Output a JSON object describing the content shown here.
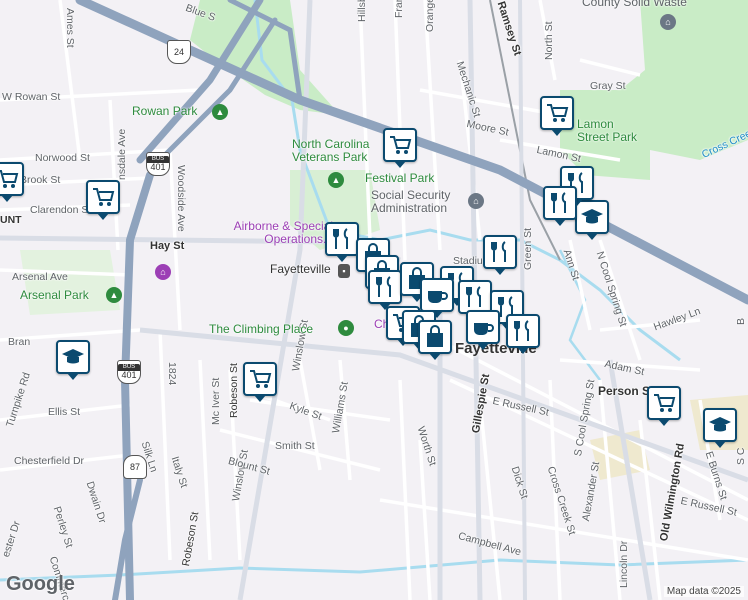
{
  "streets": {
    "blue": "Blue S",
    "ames": "Ames St",
    "w_rowan": "W Rowan St",
    "norwood": "Norwood St",
    "brook": "Brook St",
    "clarendon": "Clarendon St",
    "hay": "Hay St",
    "arsenal": "Arsenal Ave",
    "bran": "Bran",
    "turnpike": "Turnpike Rd",
    "ellis": "Ellis St",
    "chesterfield": "Chesterfield Dr",
    "perley": "Perley St",
    "dwain": "Dwain Dr",
    "chester": "ester Dr",
    "commerce": "Commerce",
    "lansdale": "nsdale Ave",
    "woodside": "Woodside Ave",
    "s1824": "1824",
    "mciver": "Mc Iver St",
    "robeson1": "Robeson St",
    "robeson2": "Robeson St",
    "silk": "Silk Ln",
    "italy": "Italy St",
    "winslow1": "Winslow St",
    "winslow2": "Winslow St",
    "kyle": "Kyle St",
    "williams": "Williams St",
    "smith": "Smith St",
    "blount": "Blount St",
    "hillsb": "Hillsb",
    "frank": "Fran",
    "orange": "Orange",
    "mechanic": "Mechanic St",
    "ramsey": "Ramsey St",
    "north": "North St",
    "gray": "Gray St",
    "moore": "Moore St",
    "lamon": "Lamon St",
    "green": "Green St",
    "ann": "Ann St",
    "ncool": "N Cool Spring St",
    "hawley": "Hawley Ln",
    "adam": "Adam St",
    "person": "Person St",
    "erussell1": "E Russell St",
    "erussell2": "E Russell St",
    "gillespie": "Gillespie St",
    "worth": "Worth St",
    "dick": "Dick St",
    "crosscreek": "Cross Creek St",
    "scool": "S Cool Spring St",
    "alexander": "Alexander St",
    "campbell": "Campbell Ave",
    "lincoln": "Lincoln Dr",
    "oldwilm": "Old Wilmington Rd",
    "burns": "E Burns St",
    "sc": "S C",
    "bst": "B",
    "crosscreek_trail": "Cross Creek",
    "stadium": "Stadium",
    "unt": "UNT",
    "chr": "Chr"
  },
  "places": {
    "county_waste": "County Solid Waste",
    "rowan_park": "Rowan Park",
    "nc_veterans_park": "North Carolina Veterans Park",
    "festival_park": "Festival Park",
    "ssa": "Social Security Administration",
    "airborne": "Airborne & Special Operations...",
    "fayetteville_station": "Fayetteville",
    "arsenal_park": "Arsenal Park",
    "climbing_place": "The Climbing Place",
    "lamon_street_park": "Lamon Street Park",
    "city": "Fayetteville"
  },
  "shields": {
    "us401a": "401",
    "us401b": "401",
    "nc24": "24",
    "i87": "87",
    "bus_label": "BUS"
  },
  "pins": [
    {
      "type": "cart-icon"
    },
    {
      "type": "cart-icon"
    },
    {
      "type": "cart-icon"
    },
    {
      "type": "cart-icon"
    },
    {
      "type": "cart-icon"
    },
    {
      "type": "cart-icon"
    },
    {
      "type": "cap-icon"
    },
    {
      "type": "cap-icon"
    },
    {
      "type": "cap-icon"
    },
    {
      "type": "fork-icon"
    },
    {
      "type": "bag-icon"
    },
    {
      "type": "cup-icon"
    }
  ],
  "footer": {
    "logo": "Google",
    "attribution": "Map data ©2025"
  },
  "colors": {
    "highway": "#8fa3bd",
    "park": "#c9ecc6",
    "water": "#a8dcef",
    "pin_border": "#0b4a6f"
  }
}
